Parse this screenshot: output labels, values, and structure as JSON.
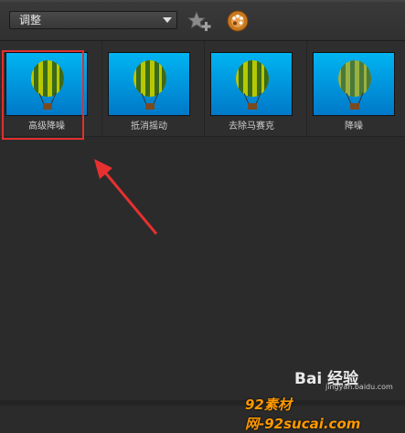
{
  "toolbar": {
    "category_selected": "调整",
    "icons": {
      "favorite": "star-plus-icon",
      "palette": "palette-icon"
    }
  },
  "presets": [
    {
      "label": "高级降噪"
    },
    {
      "label": "抵消摇动"
    },
    {
      "label": "去除马赛克"
    },
    {
      "label": "降噪"
    }
  ],
  "annotation": {
    "selection_color": "#e03030",
    "arrow_color": "#e83030"
  },
  "watermark": {
    "baidu_logo": "Bai 经验",
    "baidu_url": "jingyan.baidu.com",
    "site": "92素材网-92sucai.com"
  },
  "colors": {
    "thumb_sky_top": "#00b4f2",
    "thumb_sky_bottom": "#0078c8",
    "background": "#2b2b2b"
  }
}
